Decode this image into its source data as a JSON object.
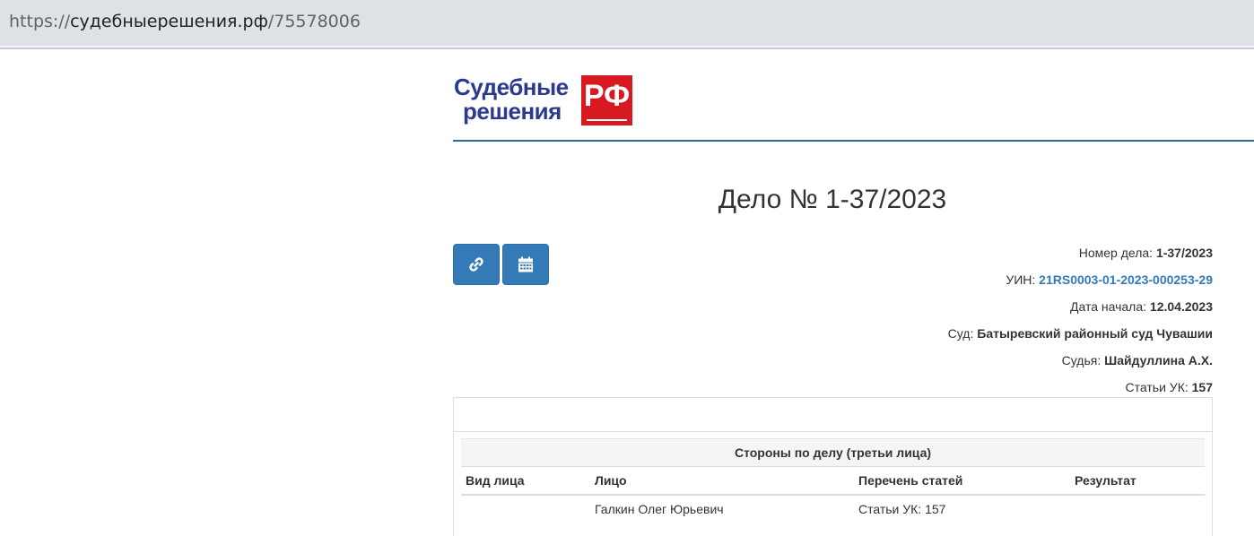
{
  "browser": {
    "url_scheme": "https://",
    "url_domain": "судебныерешения.рф",
    "url_path": "/75578006"
  },
  "logo": {
    "line1": "Судебные",
    "line2": "решения",
    "badge": "РФ",
    "colors": {
      "text": "#2b3990",
      "badge": "#d71920"
    }
  },
  "case": {
    "title": "Дело № 1-37/2023"
  },
  "buttons": {
    "link_icon": "link-icon",
    "calendar_icon": "calendar-icon"
  },
  "meta": {
    "number_label": "Номер дела:",
    "number_value": "1-37/2023",
    "uin_label": "УИН:",
    "uin_value": "21RS0003-01-2023-000253-29",
    "start_label": "Дата начала:",
    "start_value": "12.04.2023",
    "court_label": "Суд:",
    "court_value": "Батыревский районный суд Чувашии",
    "judge_label": "Судья:",
    "judge_value": "Шайдуллина А.Х.",
    "articles_label": "Статьи УК:",
    "articles_value": "157"
  },
  "parties": {
    "caption": "Стороны по делу (третьи лица)",
    "columns": [
      "Вид лица",
      "Лицо",
      "Перечень статей",
      "Результат"
    ],
    "rows": [
      [
        "",
        "Галкин Олег Юрьевич",
        "Статьи УК: 157",
        ""
      ]
    ]
  },
  "colors": {
    "accent": "#337ab7",
    "header_rule": "#2e6d8c"
  }
}
